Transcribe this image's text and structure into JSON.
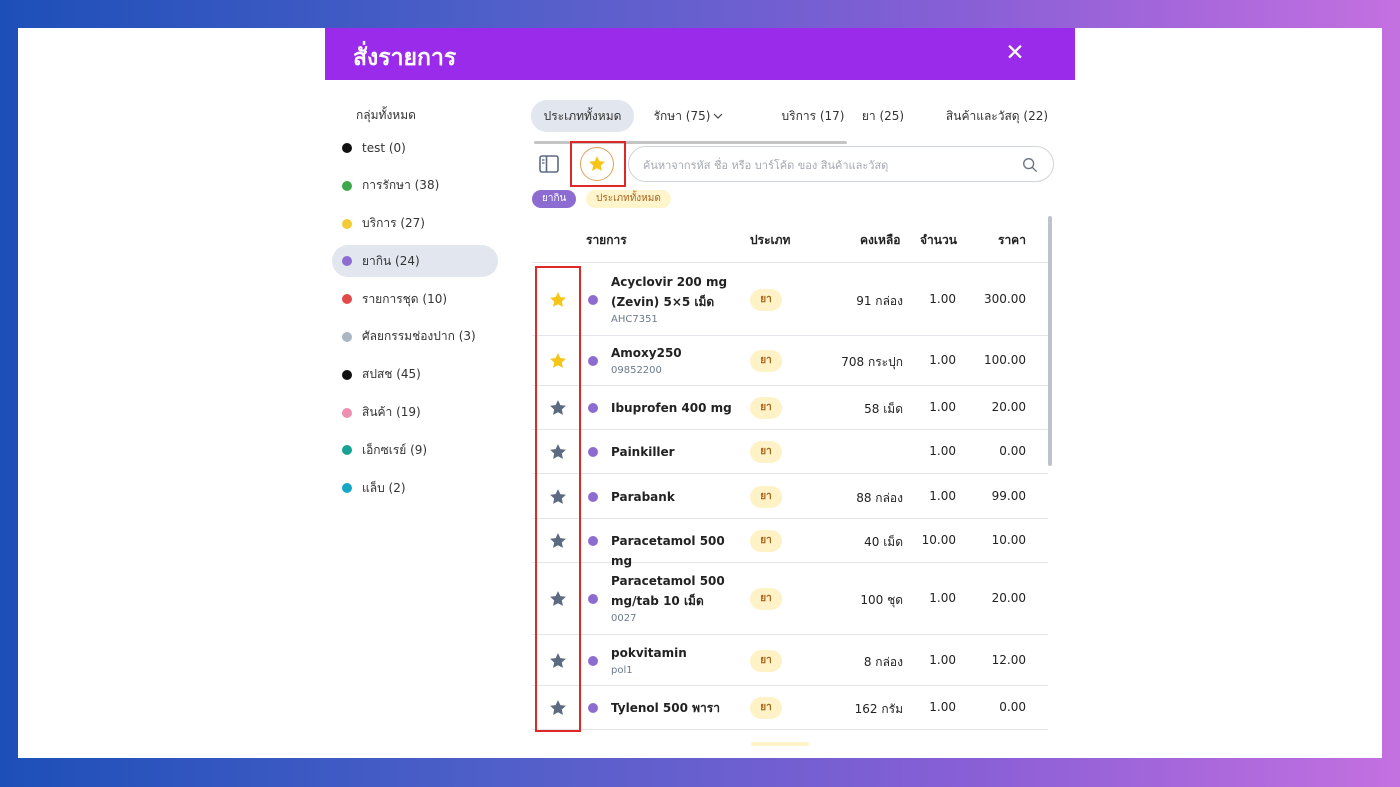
{
  "modal": {
    "title": "สั่งรายการ",
    "close_label": "✕"
  },
  "sidebar": {
    "all_label": "กลุ่มทั้งหมด",
    "items": [
      {
        "label": "test (0)",
        "color": "#111111"
      },
      {
        "label": "การรักษา (38)",
        "color": "#3ea84c"
      },
      {
        "label": "บริการ (27)",
        "color": "#f1cc34"
      },
      {
        "label": "ยากิน (24)",
        "color": "#8d6cd2",
        "active": true
      },
      {
        "label": "รายการชุด (10)",
        "color": "#e04a4a"
      },
      {
        "label": "ศัลยกรรมช่องปาก (3)",
        "color": "#aab6c2"
      },
      {
        "label": "สปสช (45)",
        "color": "#111111"
      },
      {
        "label": "สินค้า (19)",
        "color": "#ee8fb0"
      },
      {
        "label": "เอ็กซเรย์ (9)",
        "color": "#16a394"
      },
      {
        "label": "แล็บ (2)",
        "color": "#16a7c4"
      }
    ]
  },
  "tabs": [
    {
      "label": "ประเภททั้งหมด",
      "active": true
    },
    {
      "label": "รักษา (75)",
      "dropdown": true
    },
    {
      "label": "บริการ (17)"
    },
    {
      "label": "ยา (25)"
    },
    {
      "label": "สินค้าและวัสดุ (22)"
    }
  ],
  "search": {
    "placeholder": "ค้นหาจากรหัส ชื่อ หรือ บาร์โค้ด ของ สินค้าและวัสดุ",
    "value": ""
  },
  "chips": {
    "group": "ยากิน",
    "type": "ประเภททั้งหมด"
  },
  "table": {
    "headers": {
      "item": "รายการ",
      "type": "ประเภท",
      "stock": "คงเหลือ",
      "qty": "จำนวน",
      "price": "ราคา"
    },
    "rows": [
      {
        "name": "Acyclovir 200 mg (Zevin) 5×5 เม็ด",
        "code": "AHC7351",
        "type": "ยา",
        "stock": "91 กล่อง",
        "qty": "1.00",
        "price": "300.00",
        "favorite": true
      },
      {
        "name": "Amoxy250",
        "code": "09852200",
        "type": "ยา",
        "stock": "708 กระปุก",
        "qty": "1.00",
        "price": "100.00",
        "favorite": true
      },
      {
        "name": "Ibuprofen 400 mg",
        "code": "",
        "type": "ยา",
        "stock": "58 เม็ด",
        "qty": "1.00",
        "price": "20.00",
        "favorite": false
      },
      {
        "name": "Painkiller",
        "code": "",
        "type": "ยา",
        "stock": "",
        "qty": "1.00",
        "price": "0.00",
        "favorite": false
      },
      {
        "name": "Parabank",
        "code": "",
        "type": "ยา",
        "stock": "88 กล่อง",
        "qty": "1.00",
        "price": "99.00",
        "favorite": false
      },
      {
        "name": "Paracetamol 500 mg",
        "code": "",
        "type": "ยา",
        "stock": "40 เม็ด",
        "qty": "10.00",
        "price": "10.00",
        "favorite": false
      },
      {
        "name": "Paracetamol 500 mg/tab 10 เม็ด",
        "code": "0027",
        "type": "ยา",
        "stock": "100 ชุด",
        "qty": "1.00",
        "price": "20.00",
        "favorite": false
      },
      {
        "name": "pokvitamin",
        "code": "pol1",
        "type": "ยา",
        "stock": "8 กล่อง",
        "qty": "1.00",
        "price": "12.00",
        "favorite": false
      },
      {
        "name": "Tylenol 500 พารา",
        "code": "",
        "type": "ยา",
        "stock": "162 กรัม",
        "qty": "1.00",
        "price": "0.00",
        "favorite": false
      }
    ]
  },
  "colors": {
    "header": "#9b2bea",
    "star_on": "#f5c518",
    "star_off": "#5d6b82",
    "highlight": "#e02828"
  }
}
